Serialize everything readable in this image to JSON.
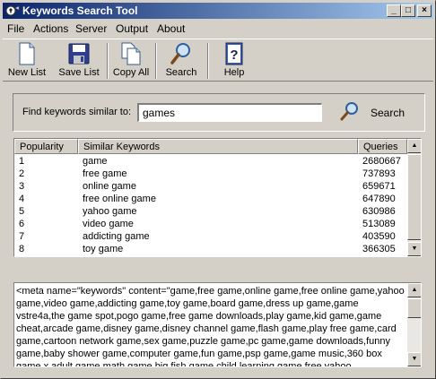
{
  "window": {
    "title": "Keywords Search Tool",
    "minimize": "_",
    "maximize": "□",
    "close": "×"
  },
  "menu": [
    "File",
    "Actions",
    "Server",
    "Output",
    "About"
  ],
  "toolbar": {
    "new_list": "New List",
    "save_list": "Save List",
    "copy_all": "Copy All",
    "search": "Search",
    "help": "Help"
  },
  "search": {
    "label": "Find keywords similar to:",
    "value": "games",
    "button_label": "Search"
  },
  "table": {
    "columns": [
      "Popularity",
      "Similar Keywords",
      "Queries"
    ],
    "rows": [
      [
        "1",
        "game",
        "2680667"
      ],
      [
        "2",
        "free game",
        "737893"
      ],
      [
        "3",
        "online game",
        "659671"
      ],
      [
        "4",
        "free online game",
        "647890"
      ],
      [
        "5",
        "yahoo game",
        "630986"
      ],
      [
        "6",
        "video game",
        "513089"
      ],
      [
        "7",
        "addicting game",
        "403590"
      ],
      [
        "8",
        "toy game",
        "366305"
      ]
    ]
  },
  "output": {
    "text": "<meta name=\"keywords\" content=\"game,free game,online game,free online game,yahoo game,video game,addicting game,toy game,board game,dress up game,game vstre4a,the game spot,pogo game,free game downloads,play game,kid game,game cheat,arcade game,disney game,disney channel game,flash game,play free game,card game,cartoon network game,sex game,puzzle game,pc game,game downloads,funny game,baby shower game,computer game,fun game,psp game,game music,360 box game x,adult game,math game,big fish game,child learning game,free yahoo game,game winner,car game,x box"
  },
  "icons": {
    "app": "keyhole-icon",
    "new_list": "new-document-icon",
    "save_list": "floppy-disk-icon",
    "copy_all": "copy-documents-icon",
    "search": "magnifier-icon",
    "help": "help-book-icon"
  },
  "colors": {
    "titlebar_start": "#0a246a",
    "titlebar_end": "#a6caf0",
    "face": "#d4d0c8"
  }
}
